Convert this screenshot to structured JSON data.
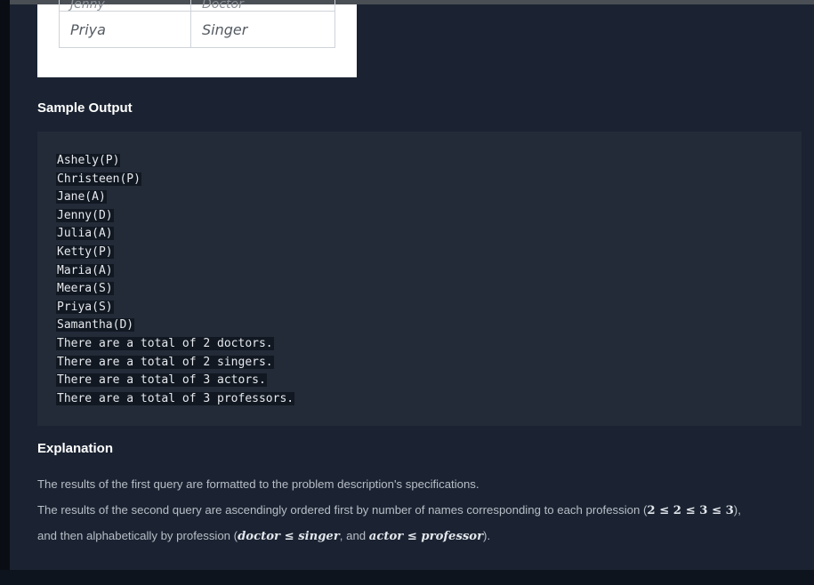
{
  "table": {
    "rows": [
      {
        "name": "Jenny",
        "occupation": "Doctor"
      },
      {
        "name": "Priya",
        "occupation": "Singer"
      }
    ]
  },
  "sample_output": {
    "heading": "Sample Output",
    "lines": [
      "Ashely(P)",
      "Christeen(P)",
      "Jane(A)",
      "Jenny(D)",
      "Julia(A)",
      "Ketty(P)",
      "Maria(A)",
      "Meera(S)",
      "Priya(S)",
      "Samantha(D)",
      "There are a total of 2 doctors.",
      "There are a total of 2 singers.",
      "There are a total of 3 actors.",
      "There are a total of 3 professors."
    ]
  },
  "explanation": {
    "heading": "Explanation",
    "p1": "The results of the first query are formatted to the problem description's specifications.",
    "p2_text": "The results of the second query are ascendingly ordered first by number of names corresponding to each profession (",
    "p2_math": "2 ≤ 2 ≤ 3 ≤ 3",
    "p2_end": "),",
    "p3_a": "and then alphabetically by profession (",
    "p3_m1": "doctor ≤ singer",
    "p3_b": ", and ",
    "p3_m2": "actor ≤ professor",
    "p3_c": ")."
  }
}
